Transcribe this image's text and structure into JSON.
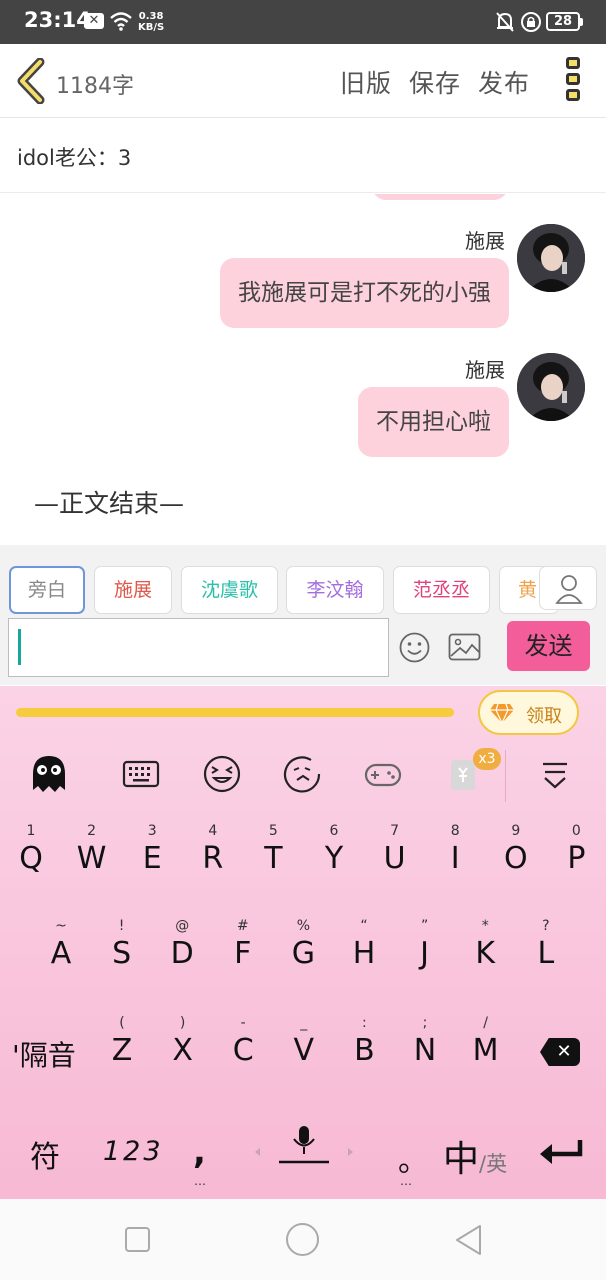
{
  "status_bar": {
    "time": "23:14",
    "speed_value": "0.38",
    "speed_unit": "KB/S",
    "battery": "28"
  },
  "header": {
    "word_count": "1184字",
    "old_version": "旧版",
    "save": "保存",
    "publish": "发布"
  },
  "config": {
    "text": "idol老公：3"
  },
  "messages": [
    {
      "sender": "施展",
      "text": "我施展可是打不死的小强"
    },
    {
      "sender": "施展",
      "text": "不用担心啦"
    }
  ],
  "end_text": "—正文结束—",
  "characters": [
    {
      "name": "旁白",
      "color": "#888888"
    },
    {
      "name": "施展",
      "color": "#e0584a"
    },
    {
      "name": "沈虞歌",
      "color": "#2bbfa9"
    },
    {
      "name": "李汶翰",
      "color": "#a36fe0"
    },
    {
      "name": "范丞丞",
      "color": "#e0437b"
    },
    {
      "name": "黄",
      "color": "#f0a14a"
    }
  ],
  "input": {
    "placeholder": "",
    "send_label": "发送"
  },
  "keyboard": {
    "claim_label": "领取",
    "badge": "x3",
    "row1": [
      {
        "num": "1",
        "letter": "Q"
      },
      {
        "num": "2",
        "letter": "W"
      },
      {
        "num": "3",
        "letter": "E"
      },
      {
        "num": "4",
        "letter": "R"
      },
      {
        "num": "5",
        "letter": "T"
      },
      {
        "num": "6",
        "letter": "Y"
      },
      {
        "num": "7",
        "letter": "U"
      },
      {
        "num": "8",
        "letter": "I"
      },
      {
        "num": "9",
        "letter": "O"
      },
      {
        "num": "0",
        "letter": "P"
      }
    ],
    "row2": [
      {
        "num": "~",
        "letter": "A"
      },
      {
        "num": "!",
        "letter": "S"
      },
      {
        "num": "@",
        "letter": "D"
      },
      {
        "num": "#",
        "letter": "F"
      },
      {
        "num": "%",
        "letter": "G"
      },
      {
        "num": "“",
        "letter": "H"
      },
      {
        "num": "”",
        "letter": "J"
      },
      {
        "num": "*",
        "letter": "K"
      },
      {
        "num": "?",
        "letter": "L"
      }
    ],
    "row3": [
      {
        "num": "(",
        "letter": "Z"
      },
      {
        "num": ")",
        "letter": "X"
      },
      {
        "num": "-",
        "letter": "C"
      },
      {
        "num": "_",
        "letter": "V"
      },
      {
        "num": ":",
        "letter": "B"
      },
      {
        "num": ";",
        "letter": "N"
      },
      {
        "num": "/",
        "letter": "M"
      }
    ],
    "separator_label": "'隔音",
    "symbols_label": "符",
    "numbers_label": "123",
    "comma": ",",
    "period": "。",
    "lang_main": "中",
    "lang_sub": "/英",
    "ellipsis": "…"
  }
}
